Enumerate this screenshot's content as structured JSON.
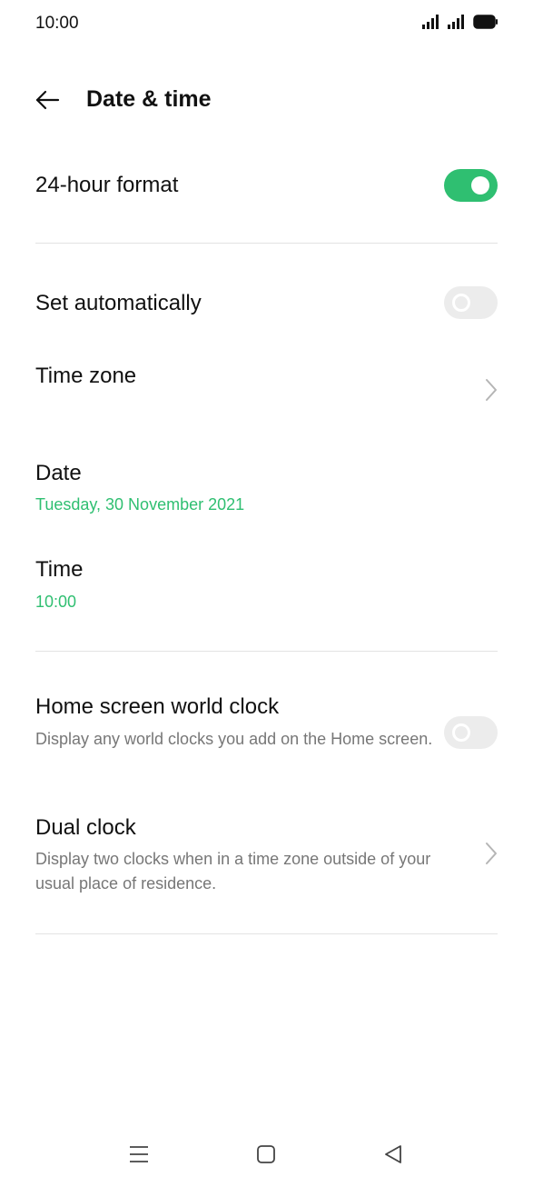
{
  "status_bar": {
    "time": "10:00",
    "icons": [
      "signal-icon",
      "signal-icon",
      "battery-icon"
    ]
  },
  "header": {
    "back_icon": "arrow-left-icon",
    "title": "Date & time"
  },
  "settings": {
    "hour_format": {
      "label": "24-hour format",
      "enabled": true
    },
    "set_automatically": {
      "label": "Set automatically",
      "enabled": false
    },
    "time_zone": {
      "label": "Time zone"
    },
    "date": {
      "label": "Date",
      "value": "Tuesday, 30 November 2021"
    },
    "time": {
      "label": "Time",
      "value": "10:00"
    },
    "world_clock": {
      "label": "Home screen world clock",
      "description": "Display any world clocks you add on the Home screen.",
      "enabled": false
    },
    "dual_clock": {
      "label": "Dual clock",
      "description": "Display two clocks when in a time zone outside of your usual place of residence."
    }
  },
  "nav_bar": {
    "icons": [
      "menu-icon",
      "home-icon",
      "back-triangle-icon"
    ]
  },
  "colors": {
    "accent": "#2fbf71",
    "divider": "#e3e3e3",
    "toggle_off": "#ececec",
    "secondary_text": "#777777"
  }
}
